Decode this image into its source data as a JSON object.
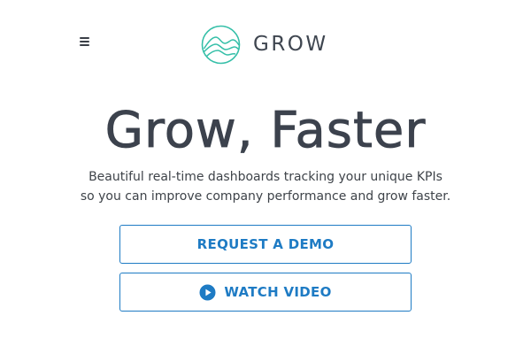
{
  "header": {
    "menu_icon": "hamburger-menu-icon",
    "logo_icon": "mountain-circle-logo-icon",
    "logo_text": "GROW",
    "brand_color": "#35bfa8"
  },
  "hero": {
    "headline": "Grow, Faster",
    "subtext": "Beautiful real-time dashboards tracking your unique KPIs so you can improve company performance and grow faster."
  },
  "actions": {
    "request_demo_label": "REQUEST A DEMO",
    "watch_video_label": "WATCH VIDEO",
    "watch_video_icon": "play-circle-icon",
    "accent_color": "#1e7bc4"
  }
}
